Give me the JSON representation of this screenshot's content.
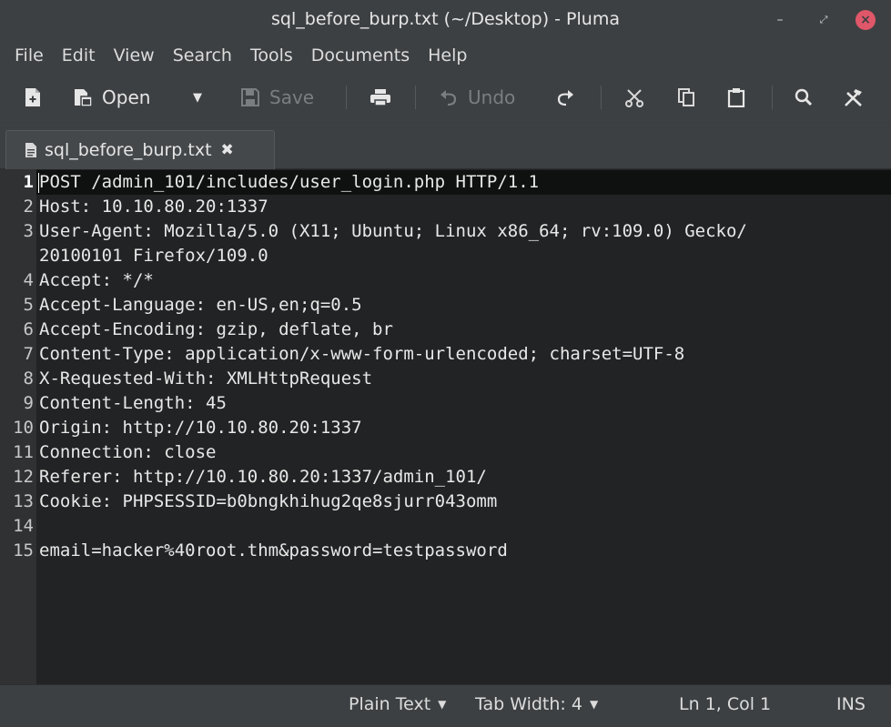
{
  "window": {
    "title": "sql_before_burp.txt (~/Desktop) - Pluma",
    "controls": [
      "minimize-icon",
      "maximize-icon",
      "close-icon"
    ]
  },
  "menu": [
    "File",
    "Edit",
    "View",
    "Search",
    "Tools",
    "Documents",
    "Help"
  ],
  "toolbar": {
    "open_label": "Open",
    "save_label": "Save",
    "undo_label": "Undo"
  },
  "tab": {
    "label": "sql_before_burp.txt"
  },
  "editor": {
    "lines": [
      {
        "num": "1",
        "text": "POST /admin_101/includes/user_login.php HTTP/1.1"
      },
      {
        "num": "2",
        "text": "Host: 10.10.80.20:1337"
      },
      {
        "num": "3",
        "text": "User-Agent: Mozilla/5.0 (X11; Ubuntu; Linux x86_64; rv:109.0) Gecko/"
      },
      {
        "num": "",
        "text": "20100101 Firefox/109.0"
      },
      {
        "num": "4",
        "text": "Accept: */*"
      },
      {
        "num": "5",
        "text": "Accept-Language: en-US,en;q=0.5"
      },
      {
        "num": "6",
        "text": "Accept-Encoding: gzip, deflate, br"
      },
      {
        "num": "7",
        "text": "Content-Type: application/x-www-form-urlencoded; charset=UTF-8"
      },
      {
        "num": "8",
        "text": "X-Requested-With: XMLHttpRequest"
      },
      {
        "num": "9",
        "text": "Content-Length: 45"
      },
      {
        "num": "10",
        "text": "Origin: http://10.10.80.20:1337"
      },
      {
        "num": "11",
        "text": "Connection: close"
      },
      {
        "num": "12",
        "text": "Referer: http://10.10.80.20:1337/admin_101/"
      },
      {
        "num": "13",
        "text": "Cookie: PHPSESSID=b0bngkhihug2qe8sjurr043omm"
      },
      {
        "num": "14",
        "text": ""
      },
      {
        "num": "15",
        "text": "email=hacker%40root.thm&password=testpassword"
      }
    ]
  },
  "status": {
    "language": "Plain Text",
    "tab_width": "Tab Width: 4",
    "position": "Ln 1, Col 1",
    "mode": "INS"
  }
}
